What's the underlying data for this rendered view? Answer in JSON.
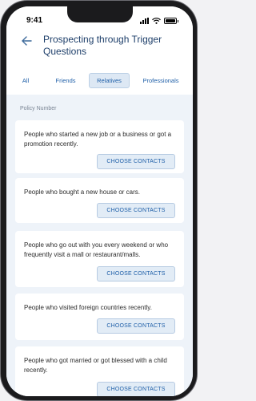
{
  "status_bar": {
    "time": "9:41"
  },
  "header": {
    "title": "Prospecting through Trigger Questions",
    "back_icon": "arrow-left-icon"
  },
  "tabs": [
    {
      "label": "All",
      "active": false
    },
    {
      "label": "Friends",
      "active": false
    },
    {
      "label": "Relatives",
      "active": true
    },
    {
      "label": "Professionals",
      "active": false
    }
  ],
  "section_label": "Policy Number",
  "cards": [
    {
      "text": "People who started a new job or a business or got a promotion recently.",
      "button": "CHOOSE CONTACTS"
    },
    {
      "text": "People who bought a new house or cars.",
      "button": "CHOOSE CONTACTS"
    },
    {
      "text": "People who go out with you every weekend or who frequently visit a mall or restaurant/malls.",
      "button": "CHOOSE CONTACTS"
    },
    {
      "text": "People who visited foreign countries recently.",
      "button": "CHOOSE CONTACTS"
    },
    {
      "text": "People who got married or got blessed with a child recently.",
      "button": "CHOOSE CONTACTS"
    }
  ],
  "colors": {
    "accent": "#1f5fa8",
    "title": "#1e3f6a",
    "background": "#eef3f9"
  }
}
